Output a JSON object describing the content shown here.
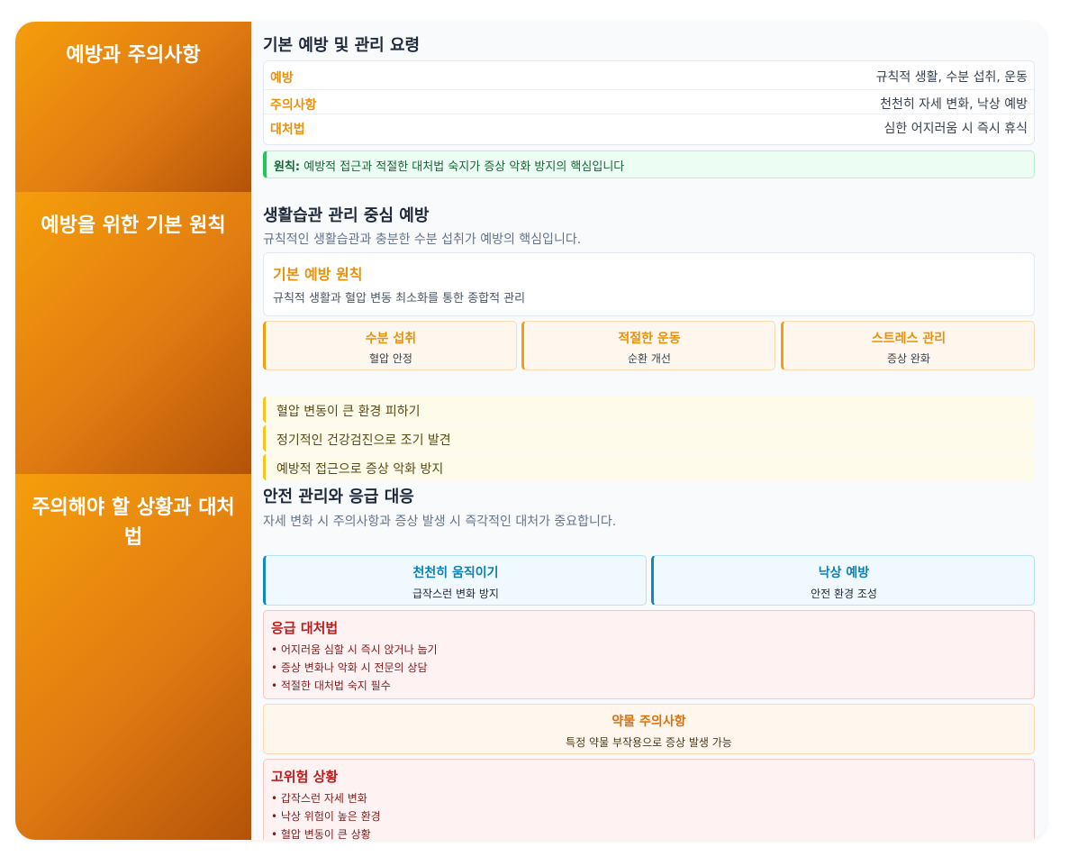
{
  "sections": [
    {
      "side_title": "예방과 주의사항",
      "heading": "기본 예방 및 관리 요령",
      "rows": [
        {
          "label": "예방",
          "value": "규칙적 생활, 수분 섭취, 운동"
        },
        {
          "label": "주의사항",
          "value": "천천히 자세 변화, 낙상 예방"
        },
        {
          "label": "대처법",
          "value": "심한 어지러움 시 즉시 휴식"
        }
      ],
      "principle_label": "원칙:",
      "principle_text": " 예방적 접근과 적절한 대처법 숙지가 증상 악화 방지의 핵심입니다"
    },
    {
      "side_title": "예방을 위한 기본 원칙",
      "heading": "생활습관 관리 중심 예방",
      "subtitle": "규칙적인 생활습관과 충분한 수분 섭취가 예방의 핵심입니다.",
      "basic_title": "기본 예방 원칙",
      "basic_desc": "규칙적 생활과 혈압 변동 최소화를 통한 종합적 관리",
      "pillars": [
        {
          "title": "수분 섭취",
          "sub": "혈압 안정"
        },
        {
          "title": "적절한 운동",
          "sub": "순환 개선"
        },
        {
          "title": "스트레스 관리",
          "sub": "증상 완화"
        }
      ],
      "tips": [
        "혈압 변동이 큰 환경 피하기",
        "정기적인 건강검진으로 조기 발견",
        "예방적 접근으로 증상 악화 방지"
      ]
    },
    {
      "side_title": "주의해야 할 상황과 대처법",
      "heading": "안전 관리와 응급 대응",
      "subtitle": "자세 변화 시 주의사항과 증상 발생 시 즉각적인 대처가 중요합니다.",
      "moves": [
        {
          "title": "천천히 움직이기",
          "sub": "급작스런 변화 방지"
        },
        {
          "title": "낙상 예방",
          "sub": "안전 환경 조성"
        }
      ],
      "emergency": {
        "title": "응급 대처법",
        "items": [
          "• 어지러움 심할 시 즉시 앉거나 눕기",
          "• 증상 변화나 악화 시 전문의 상담",
          "• 적절한 대처법 숙지 필수"
        ]
      },
      "drug": {
        "title": "약물 주의사항",
        "sub": "특정 약물 부작용으로 증상 발생 가능"
      },
      "risk": {
        "title": "고위험 상황",
        "items": [
          "• 갑작스런 자세 변화",
          "• 낙상 위험이 높은 환경",
          "• 혈압 변동이 큰 상황"
        ]
      }
    }
  ]
}
